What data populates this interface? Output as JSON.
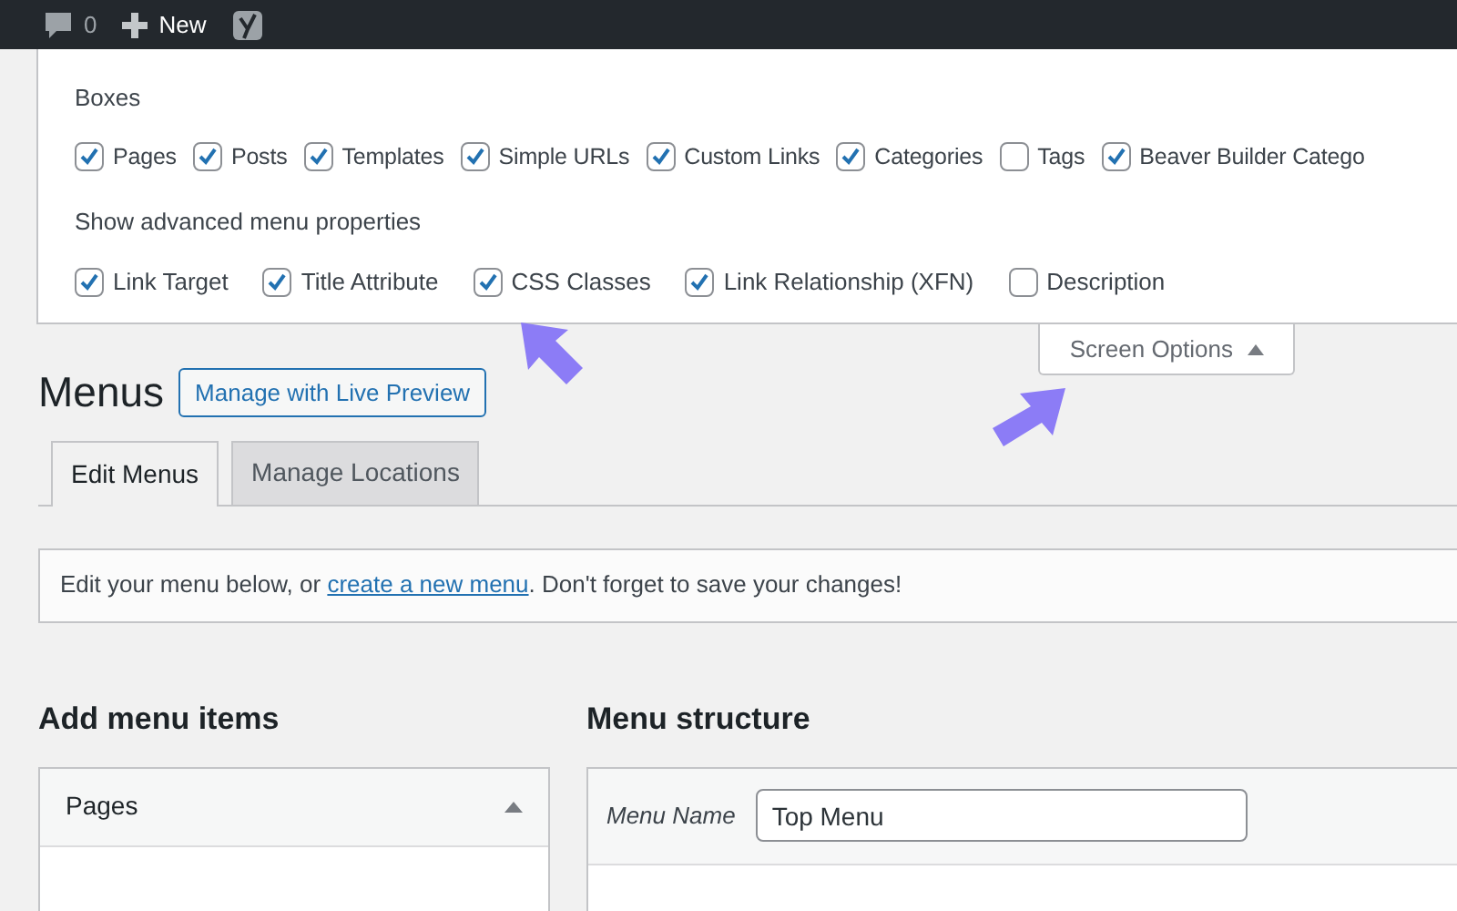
{
  "admin_bar": {
    "comments_count": "0",
    "new_label": "New"
  },
  "screen_options": {
    "boxes_title": "Boxes",
    "boxes": [
      {
        "label": "Pages",
        "checked": true
      },
      {
        "label": "Posts",
        "checked": true
      },
      {
        "label": "Templates",
        "checked": true
      },
      {
        "label": "Simple URLs",
        "checked": true
      },
      {
        "label": "Custom Links",
        "checked": true
      },
      {
        "label": "Categories",
        "checked": true
      },
      {
        "label": "Tags",
        "checked": false
      },
      {
        "label": "Beaver Builder Catego",
        "checked": true
      }
    ],
    "advanced_title": "Show advanced menu properties",
    "advanced": [
      {
        "label": "Link Target",
        "checked": true
      },
      {
        "label": "Title Attribute",
        "checked": true
      },
      {
        "label": "CSS Classes",
        "checked": true
      },
      {
        "label": "Link Relationship (XFN)",
        "checked": true
      },
      {
        "label": "Description",
        "checked": false
      }
    ],
    "toggle_label": "Screen Options",
    "expanded": true
  },
  "page_title": "Menus",
  "live_preview_button": "Manage with Live Preview",
  "tabs": [
    {
      "label": "Edit Menus",
      "selected": true
    },
    {
      "label": "Manage Locations",
      "selected": false
    }
  ],
  "notice": {
    "before": "Edit your menu below, or ",
    "link": "create a new menu",
    "after": ". Don't forget to save your changes!"
  },
  "add_items": {
    "title": "Add menu items",
    "panel_title": "Pages"
  },
  "structure": {
    "title": "Menu structure",
    "name_label": "Menu Name",
    "name_value": "Top Menu"
  }
}
